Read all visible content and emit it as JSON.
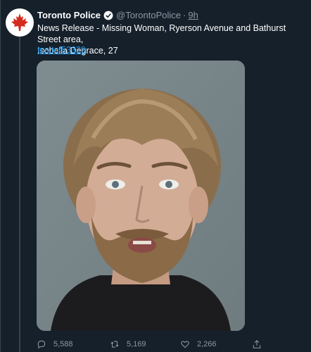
{
  "tweet": {
    "author_name": "Toronto Police",
    "handle": "@TorontoPolice",
    "separator": "·",
    "time": "9h",
    "text_line1": "News Release - Missing Woman, Ryerson Avenue and Bathurst Street area,",
    "text_line2": "Isobella Degrace, 27",
    "link": "tps.to/53329"
  },
  "actions": {
    "replies": "5,588",
    "retweets": "5,169",
    "likes": "2,266"
  },
  "icons": {
    "avatar": "maple-leaf-icon",
    "verified": "verified-badge-icon",
    "reply": "reply-icon",
    "retweet": "retweet-icon",
    "like": "heart-icon",
    "share": "share-icon"
  },
  "colors": {
    "background": "#15202b",
    "accent": "#1d9bf0",
    "muted": "#8b98a5"
  }
}
